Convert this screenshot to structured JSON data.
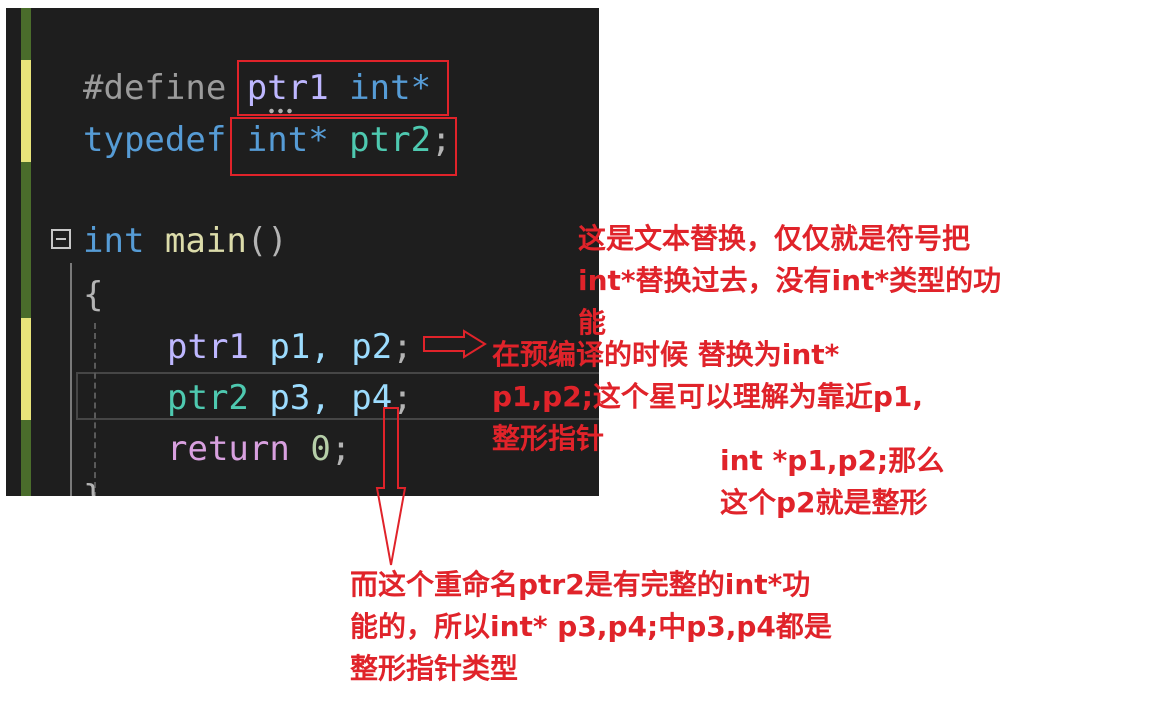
{
  "editor": {
    "lines": {
      "define_kw": "#define",
      "define_name": "ptr1",
      "define_value": "int*",
      "typedef_kw": "typedef",
      "typedef_type": "int*",
      "typedef_name": "ptr2",
      "typedef_semi": ";",
      "main_ret": "int",
      "main_name": "main",
      "main_parens": "()",
      "brace_open": "{",
      "l1_type": "ptr1",
      "l1_vars": "p1, p2",
      "l1_semi": ";",
      "l2_type": "ptr2",
      "l2_vars": "p3, p4",
      "l2_semi": ";",
      "ret_kw": "return",
      "ret_val": "0",
      "ret_semi": ";",
      "brace_close": "}"
    }
  },
  "annotations": {
    "define_note": "这是文本替换，仅仅就是符号把\nint*替换过去，没有int*类型的功\n能",
    "precompile_note": "在预编译的时候 替换为int*\np1,p2;这个星可以理解为靠近p1,\n整形指针",
    "p2_note": "int *p1,p2;那么\n这个p2就是整形",
    "typedef_note": "而这个重命名ptr2是有完整的int*功\n能的，所以int* p3,p4;中p3,p4都是\n整形指针类型"
  },
  "colors": {
    "editor_bg": "#1e1e1e",
    "annotation_red": "#e0232a",
    "gutter_green": "#4a6c2b",
    "gutter_yellow": "#e8e47a"
  }
}
